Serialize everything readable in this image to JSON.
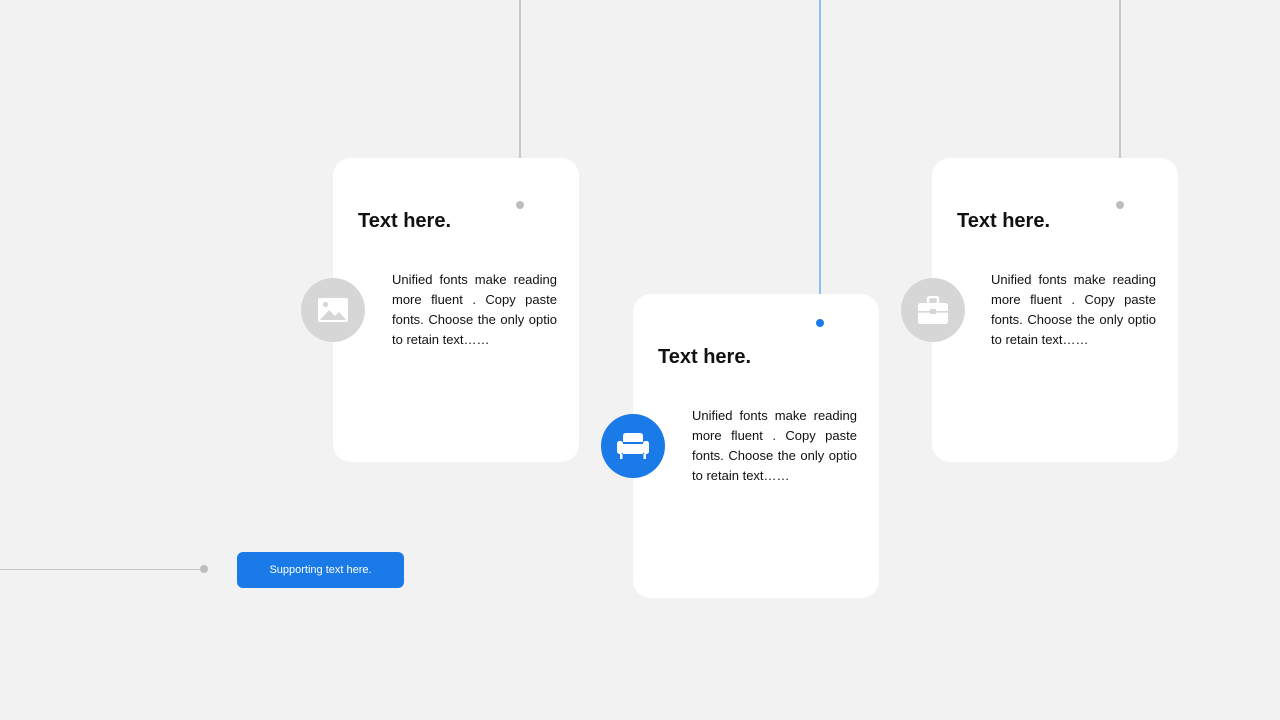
{
  "cards": [
    {
      "title": "Text here.",
      "body": "Unified fonts make reading more fluent . Copy paste fonts. Choose the only optio to retain text……",
      "icon": "image-icon",
      "highlighted": false
    },
    {
      "title": "Text here.",
      "body": "Unified fonts make reading more fluent . Copy paste fonts. Choose the only optio to retain text……",
      "icon": "sofa-icon",
      "highlighted": true
    },
    {
      "title": "Text here.",
      "body": "Unified fonts make reading more fluent . Copy paste fonts. Choose the only optio to retain text……",
      "icon": "briefcase-icon",
      "highlighted": false
    }
  ],
  "supporting_button": {
    "label": "Supporting text here."
  },
  "colors": {
    "accent": "#1a7ae8",
    "background": "#f2f2f2",
    "card": "#ffffff",
    "muted_icon_bg": "#d6d6d6",
    "line": "#c8c8c8"
  }
}
